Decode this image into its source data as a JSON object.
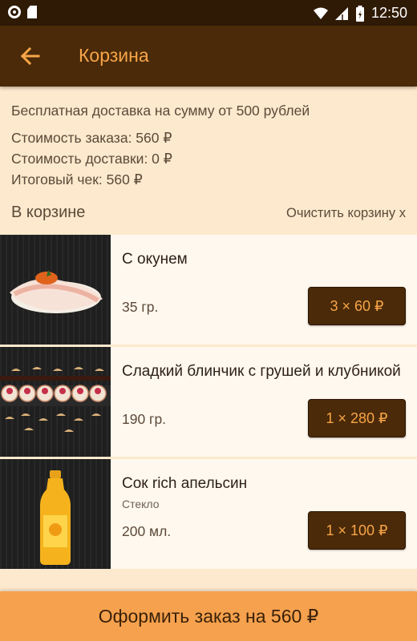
{
  "status_bar": {
    "time": "12:50"
  },
  "app_bar": {
    "title": "Корзина"
  },
  "summary": {
    "free_delivery": "Бесплатная доставка на сумму от 500 рублей",
    "order_cost": "Стоимость заказа: 560 ₽",
    "delivery_cost": "Стоимость доставки: 0 ₽",
    "total": "Итоговый чек: 560 ₽"
  },
  "cart": {
    "title": "В корзине",
    "clear_label": "Очистить корзину x",
    "items": [
      {
        "name": "С окунем",
        "variant": "",
        "weight": "35 гр.",
        "price": "3 × 60 ₽"
      },
      {
        "name": "Сладкий блинчик с грушей и клубникой",
        "variant": "",
        "weight": "190 гр.",
        "price": "1 × 280 ₽"
      },
      {
        "name": "Сок rich апельсин",
        "variant": "Стекло",
        "weight": "200 мл.",
        "price": "1 × 100 ₽"
      }
    ]
  },
  "checkout": {
    "label": "Оформить заказ на 560 ₽"
  },
  "colors": {
    "accent": "#f8a548",
    "brand_dark": "#4a2a08",
    "background": "#fde9cd"
  }
}
